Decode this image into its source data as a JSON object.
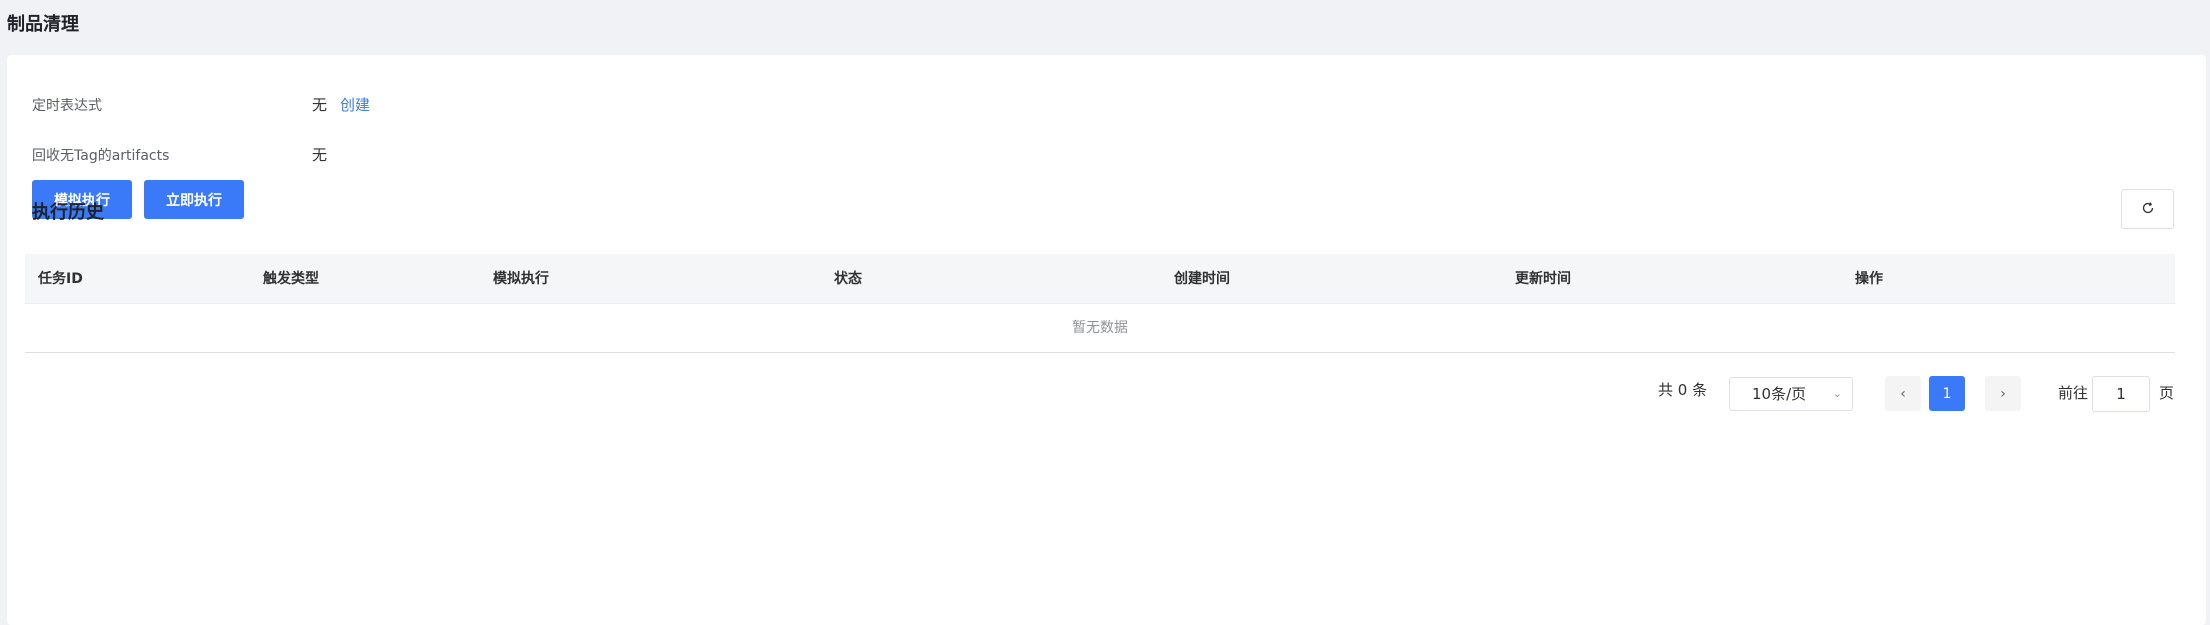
{
  "header": {
    "title": "制品清理"
  },
  "config": {
    "cron_label": "定时表达式",
    "cron_value": "无",
    "cron_link": "创建",
    "untagged_label": "回收无Tag的artifacts",
    "untagged_value": "无"
  },
  "actions": {
    "dry_run": "模拟执行",
    "run_now": "立即执行"
  },
  "history": {
    "title": "执行历史",
    "columns": [
      "任务ID",
      "触发类型",
      "模拟执行",
      "状态",
      "创建时间",
      "更新时间",
      "操作"
    ],
    "empty_text": "暂无数据"
  },
  "pagination": {
    "total": "共 0 条",
    "page_size": "10条/页",
    "current_page": "1",
    "goto_prefix": "前往",
    "goto_value": "1",
    "goto_suffix": "页"
  },
  "colors": {
    "primary": "#3a7af8",
    "link": "#3a7ee8",
    "background": "#f0f2f5"
  },
  "icons": {
    "refresh": "refresh-icon",
    "prev": "chevron-left-icon",
    "next": "chevron-right-icon",
    "dropdown": "chevron-down-icon"
  }
}
